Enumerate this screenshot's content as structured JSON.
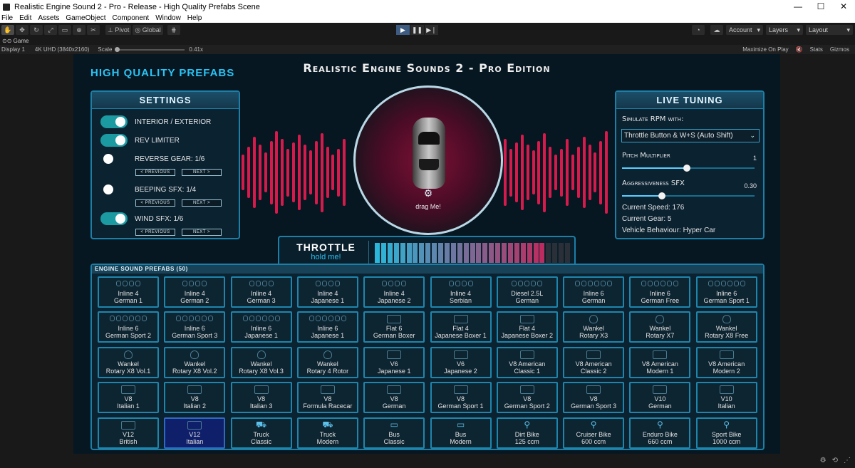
{
  "window": {
    "title": "Realistic Engine Sound 2 - Pro - Release - High Quality Prefabs Scene",
    "minimize": "—",
    "maximize": "☐",
    "close": "✕"
  },
  "menu": [
    "File",
    "Edit",
    "Assets",
    "GameObject",
    "Component",
    "Window",
    "Help"
  ],
  "toolbar": {
    "pivot": "Pivot",
    "global": "Global",
    "account": "Account",
    "layers": "Layers",
    "layout": "Layout"
  },
  "gameview": {
    "tab": "Game",
    "display": "Display 1",
    "resolution": "4K UHD (3840x2160)",
    "scale_label": "Scale",
    "scale_value": "0.41x",
    "maximize_on_play": "Maximize On Play",
    "stats": "Stats",
    "gizmos": "Gizmos"
  },
  "scene": {
    "hq_title": "HIGH QUALITY PREFABS",
    "main_title": "Realistic Engine Sounds 2 - Pro Edition",
    "drag_label": "drag Me!"
  },
  "settings": {
    "header": "SETTINGS",
    "interior": "INTERIOR / EXTERIOR",
    "rev_limiter": "REV LIMITER",
    "reverse_gear": "REVERSE GEAR: 1/6",
    "beeping": "BEEPING SFX: 1/4",
    "wind": "WIND SFX: 1/6",
    "previous": "< PREVIOUS",
    "next": "NEXT >"
  },
  "live_tuning": {
    "header": "LIVE TUNING",
    "simulate_label": "Simulate RPM with:",
    "simulate_value": "Throttle Button & W+S (Auto Shift)",
    "pitch_label": "Pitch Multiplier",
    "pitch_value": "1",
    "pitch_fraction": 0.49,
    "aggr_label": "Aggressiveness SFX",
    "aggr_value": "0.30",
    "aggr_fraction": 0.3,
    "speed": "Current Speed: 176",
    "gear": "Current Gear: 5",
    "behaviour": "Vehicle Behaviour: Hyper Car"
  },
  "throttle": {
    "title": "THROTTLE",
    "sub": "hold me!",
    "level": 0.87
  },
  "prefabs": {
    "header": "ENGINE SOUND PREFABS (50)",
    "items": [
      {
        "l1": "Inline 4",
        "l2": "German 1",
        "icon": "cyl4"
      },
      {
        "l1": "Inline 4",
        "l2": "German 2",
        "icon": "cyl4"
      },
      {
        "l1": "Inline 4",
        "l2": "German 3",
        "icon": "cyl4"
      },
      {
        "l1": "Inline 4",
        "l2": "Japanese 1",
        "icon": "cyl4"
      },
      {
        "l1": "Inline 4",
        "l2": "Japanese 2",
        "icon": "cyl4"
      },
      {
        "l1": "Inline 4",
        "l2": "Serbian",
        "icon": "cyl4"
      },
      {
        "l1": "Diesel 2.5L",
        "l2": "German",
        "icon": "cyl5"
      },
      {
        "l1": "Inline 6",
        "l2": "German",
        "icon": "cyl6"
      },
      {
        "l1": "Inline 6",
        "l2": "German Free",
        "icon": "cyl6"
      },
      {
        "l1": "Inline 6",
        "l2": "German Sport 1",
        "icon": "cyl6"
      },
      {
        "l1": "Inline 6",
        "l2": "German Sport 2",
        "icon": "cyl6"
      },
      {
        "l1": "Inline 6",
        "l2": "German Sport 3",
        "icon": "cyl6"
      },
      {
        "l1": "Inline 6",
        "l2": "Japanese 1",
        "icon": "cyl6"
      },
      {
        "l1": "Inline 6",
        "l2": "Japanese 1",
        "icon": "cyl6"
      },
      {
        "l1": "Flat 6",
        "l2": "German Boxer",
        "icon": "vblock"
      },
      {
        "l1": "Flat 4",
        "l2": "Japanese Boxer 1",
        "icon": "vblock"
      },
      {
        "l1": "Flat 4",
        "l2": "Japanese Boxer 2",
        "icon": "vblock"
      },
      {
        "l1": "Wankel",
        "l2": "Rotary X3",
        "icon": "rotary"
      },
      {
        "l1": "Wankel",
        "l2": "Rotary X7",
        "icon": "rotary"
      },
      {
        "l1": "Wankel",
        "l2": "Rotary X8 Free",
        "icon": "rotary"
      },
      {
        "l1": "Wankel",
        "l2": "Rotary X8 Vol.1",
        "icon": "rotary"
      },
      {
        "l1": "Wankel",
        "l2": "Rotary X8 Vol.2",
        "icon": "rotary"
      },
      {
        "l1": "Wankel",
        "l2": "Rotary X8 Vol.3",
        "icon": "rotary"
      },
      {
        "l1": "Wankel",
        "l2": "Rotary 4 Rotor",
        "icon": "rotary"
      },
      {
        "l1": "V6",
        "l2": "Japanese 1",
        "icon": "vblock"
      },
      {
        "l1": "V6",
        "l2": "Japanese 2",
        "icon": "vblock"
      },
      {
        "l1": "V8 American",
        "l2": "Classic 1",
        "icon": "vblock"
      },
      {
        "l1": "V8 American",
        "l2": "Classic 2",
        "icon": "vblock"
      },
      {
        "l1": "V8 American",
        "l2": "Modern 1",
        "icon": "vblock"
      },
      {
        "l1": "V8 American",
        "l2": "Modern 2",
        "icon": "vblock"
      },
      {
        "l1": "V8",
        "l2": "Italian 1",
        "icon": "vblock"
      },
      {
        "l1": "V8",
        "l2": "Italian 2",
        "icon": "vblock"
      },
      {
        "l1": "V8",
        "l2": "Italian 3",
        "icon": "vblock"
      },
      {
        "l1": "V8",
        "l2": "Formula Racecar",
        "icon": "vblock"
      },
      {
        "l1": "V8",
        "l2": "German",
        "icon": "vblock"
      },
      {
        "l1": "V8",
        "l2": "German Sport 1",
        "icon": "vblock"
      },
      {
        "l1": "V8",
        "l2": "German Sport 2",
        "icon": "vblock"
      },
      {
        "l1": "V8",
        "l2": "German Sport 3",
        "icon": "vblock"
      },
      {
        "l1": "V10",
        "l2": "German",
        "icon": "vblock"
      },
      {
        "l1": "V10",
        "l2": "Italian",
        "icon": "vblock"
      },
      {
        "l1": "V12",
        "l2": "British",
        "icon": "vblock"
      },
      {
        "l1": "V12",
        "l2": "Italian",
        "icon": "vblock",
        "selected": true
      },
      {
        "l1": "Truck",
        "l2": "Classic",
        "icon": "truck"
      },
      {
        "l1": "Truck",
        "l2": "Modern",
        "icon": "truck"
      },
      {
        "l1": "Bus",
        "l2": "Classic",
        "icon": "bus"
      },
      {
        "l1": "Bus",
        "l2": "Modern",
        "icon": "bus"
      },
      {
        "l1": "Dirt Bike",
        "l2": "125 ccm",
        "icon": "bike"
      },
      {
        "l1": "Cruiser Bike",
        "l2": "600 ccm",
        "icon": "bike"
      },
      {
        "l1": "Enduro Bike",
        "l2": "660 ccm",
        "icon": "bike"
      },
      {
        "l1": "Sport Bike",
        "l2": "1000 ccm",
        "icon": "bike"
      }
    ]
  },
  "colors": {
    "accent": "#1c7fa8",
    "title_cyan": "#29c4f6",
    "wave": "#d61b4c",
    "toggle_on": "#1b9aa2"
  }
}
